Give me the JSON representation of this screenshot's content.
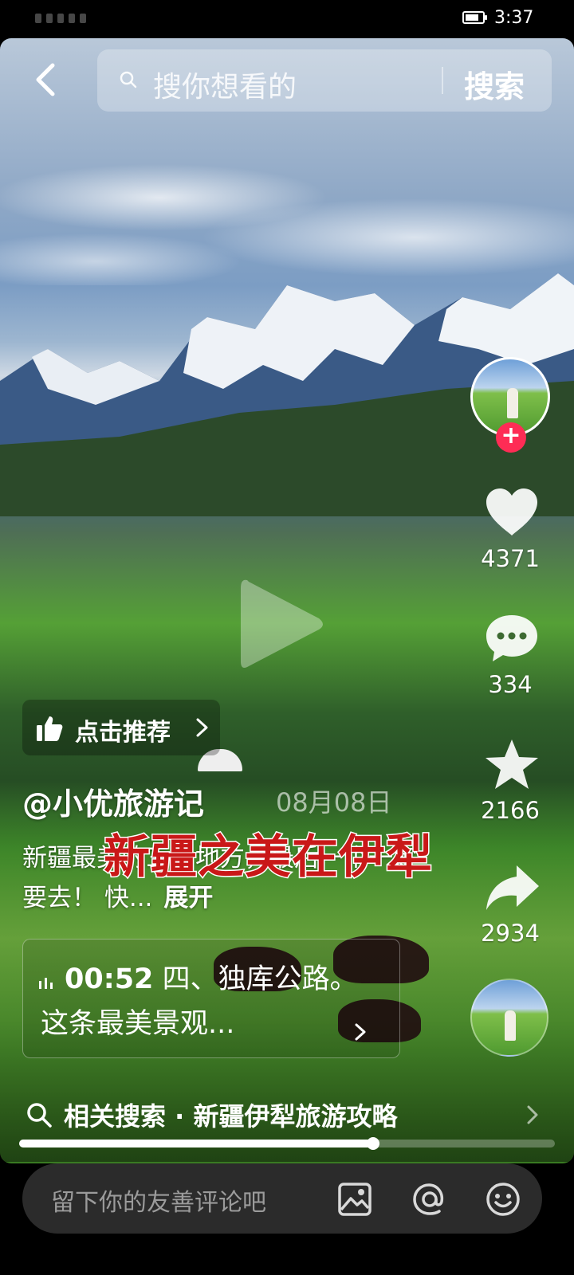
{
  "status_bar": {
    "time": "3:37",
    "battery_level": 0.8
  },
  "search": {
    "placeholder": "搜你想看的",
    "button_label": "搜索"
  },
  "rail": {
    "likes": "4371",
    "comments": "334",
    "favorites": "2166",
    "shares": "2934"
  },
  "recommend": {
    "label": "点击推荐"
  },
  "post": {
    "author": "@小优旅游记",
    "date": "08月08日",
    "overlay_title": "新疆之美在伊犁",
    "description": "新疆最美的三个地方，最后一个一定要去！ 快...",
    "expand_label": "展开"
  },
  "chapter": {
    "timestamp": "00:52",
    "text": "四、独库公路。这条最美景观..."
  },
  "related_search": {
    "label": "相关搜索 · 新疆伊犁旅游攻略"
  },
  "playback": {
    "progress": 0.66
  },
  "comment": {
    "placeholder": "留下你的友善评论吧"
  },
  "colors": {
    "accent": "#fe2c55",
    "overlay_title": "#c91818",
    "comment_bar": "#2b2b2b"
  },
  "icons": [
    "back-icon",
    "search-icon",
    "play-icon",
    "heart-icon",
    "comment-icon",
    "star-icon",
    "share-icon",
    "thumbs-up-icon",
    "image-icon",
    "at-icon",
    "emoji-icon"
  ]
}
